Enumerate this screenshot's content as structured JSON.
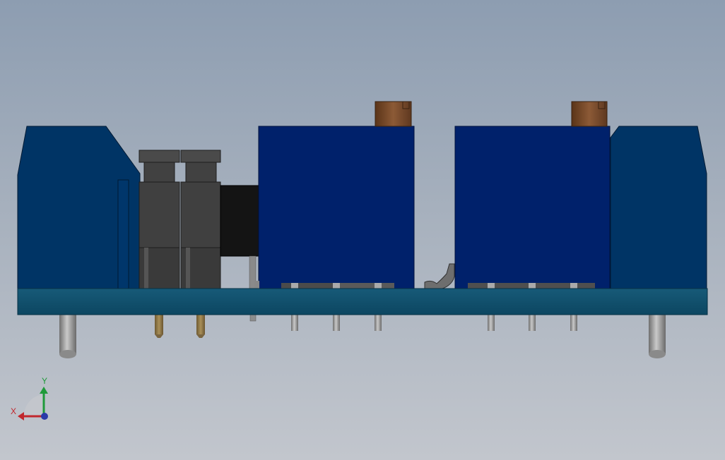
{
  "viewport": {
    "background_top": "#8d9db1",
    "background_bottom": "#c2c6cd"
  },
  "colors": {
    "pcb": "#0f4d6a",
    "housing": "#003465",
    "relay_body": "#00216b",
    "knob": "#7a4a2a",
    "connector": "#3f3f3f",
    "black_part": "#1a1a1a",
    "pin_steel": "#9a9a9a",
    "pin_brass": "#8b7548"
  },
  "triad": {
    "x_label": "X",
    "y_label": "Y",
    "x_color": "#c1272d",
    "y_color": "#1f9a3a",
    "z_color": "#2b3aa8",
    "icon": "coordinate-triad-icon"
  }
}
